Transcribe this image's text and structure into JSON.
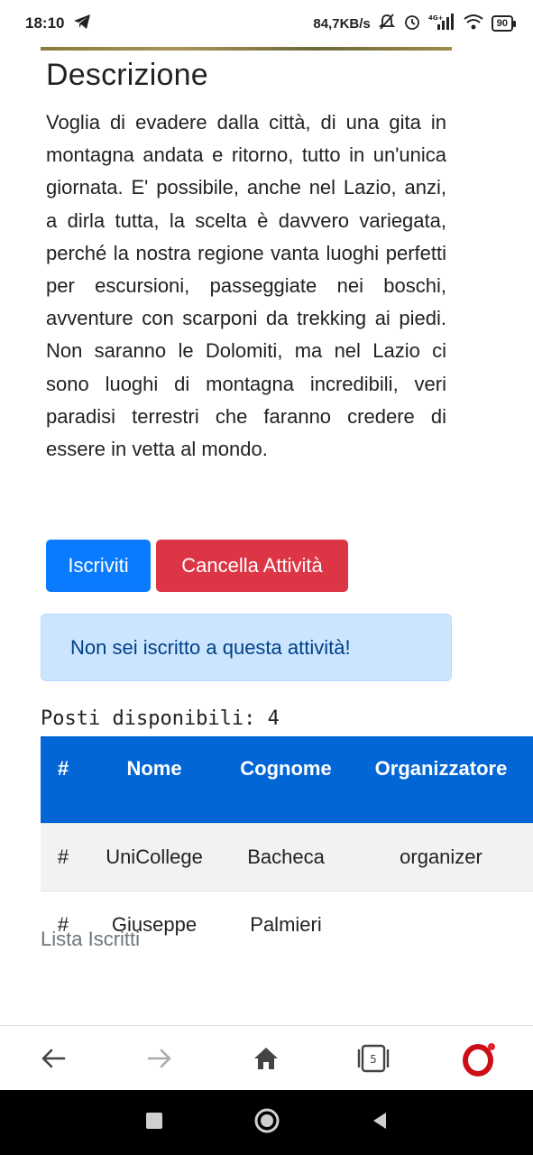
{
  "status_bar": {
    "time": "18:10",
    "network_speed": "84,7KB/s",
    "battery": "90",
    "icons": [
      "telegram-icon",
      "mute-icon",
      "alarm-icon",
      "signal-icon",
      "wifi-icon",
      "battery-icon"
    ]
  },
  "description": {
    "title": "Descrizione",
    "text": "Voglia di evadere dalla città, di una gita in montagna andata e ritorno, tutto in un'unica giornata. E' possibile, anche nel Lazio, anzi, a dirla tutta, la scelta è davvero variegata, perché la nostra regione vanta luoghi perfetti per escursioni, passeggiate nei boschi, avventure con scarponi da trekking ai piedi. Non saranno le Dolomiti, ma nel Lazio ci sono luoghi di montagna incredibili, veri paradisi terrestri che faranno credere di essere in vetta al mondo."
  },
  "buttons": {
    "subscribe": "Iscriviti",
    "cancel": "Cancella Attività"
  },
  "alert": {
    "text": "Non sei iscritto a questa attività!"
  },
  "seats": {
    "text": "Posti disponibili: 4"
  },
  "table": {
    "headers": [
      "#",
      "Nome",
      "Cognome",
      "Organizzatore"
    ],
    "rows": [
      [
        "#",
        "UniCollege",
        "Bacheca",
        "organizer"
      ],
      [
        "#",
        "Giuseppe",
        "Palmieri",
        ""
      ]
    ]
  },
  "list_title": "Lista Iscritti",
  "browser_nav": {
    "tabs_count": "5"
  },
  "colors": {
    "primary": "#0a7bff",
    "danger": "#dc3545",
    "table_header": "#0366d6",
    "alert_bg": "#cce5ff",
    "alert_text": "#004085"
  }
}
